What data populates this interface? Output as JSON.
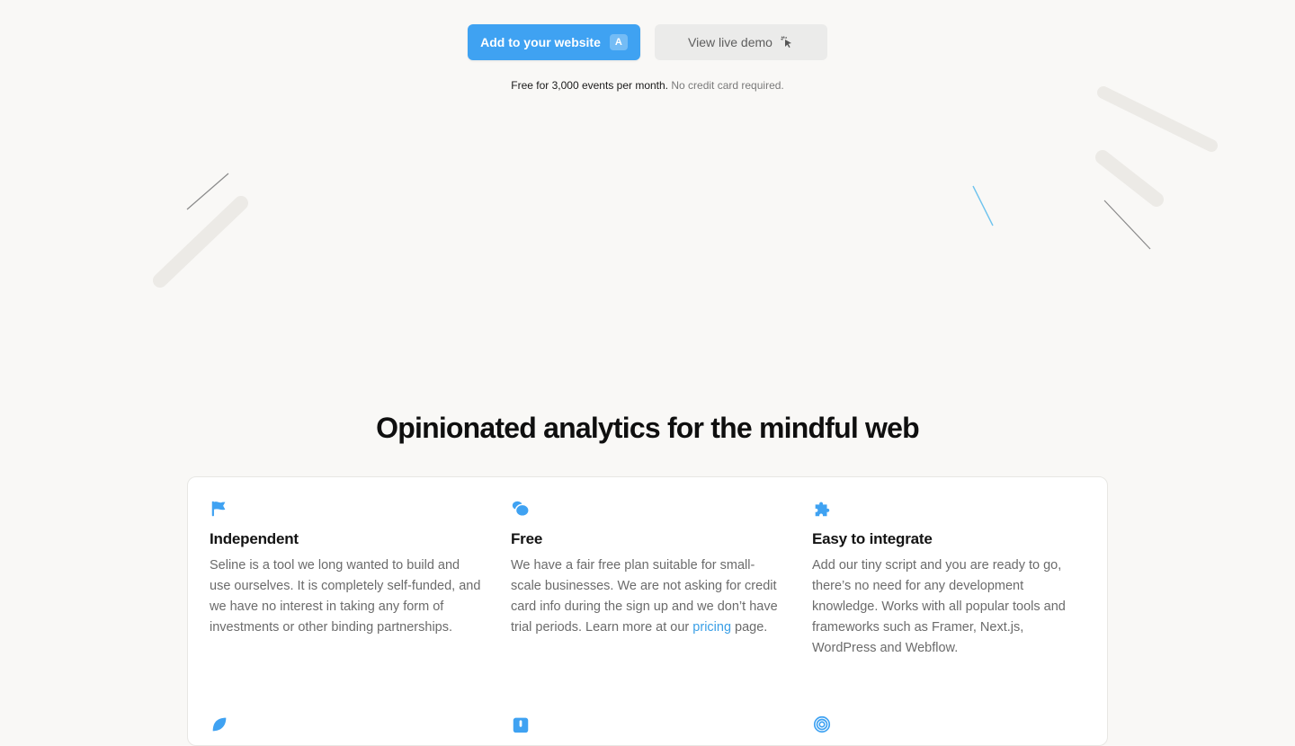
{
  "hero": {
    "primary_button": "Add to your website",
    "primary_shortcut": "A",
    "secondary_button": "View live demo",
    "note_strong": "Free for 3,000 events per month.",
    "note_muted": "No credit card required."
  },
  "section": {
    "title": "Opinionated analytics for the mindful web"
  },
  "features": [
    {
      "icon": "flag-icon",
      "title": "Independent",
      "text": "Seline is a tool we long wanted to build and use ourselves. It is completely self-funded, and we have no interest in taking any form of investments or other binding partnerships."
    },
    {
      "icon": "coins-icon",
      "title": "Free",
      "text_before": "We have a fair free plan suitable for small-scale businesses. We are not asking for credit card info during the sign up and we don’t have trial periods. Learn more at our",
      "link": "pricing",
      "text_after": "page."
    },
    {
      "icon": "puzzle-icon",
      "title": "Easy to integrate",
      "text": "Add our tiny script and you are ready to go, there’s no need for any development knowledge. Works with all popular tools and frameworks such as Framer, Next.js, WordPress and Webflow."
    }
  ],
  "next_row_icons": [
    "leaf-icon",
    "lock-icon",
    "fingerprint-icon"
  ],
  "colors": {
    "accent": "#3fa2f2",
    "background": "#f9f8f6",
    "link": "#3a9fe6"
  }
}
